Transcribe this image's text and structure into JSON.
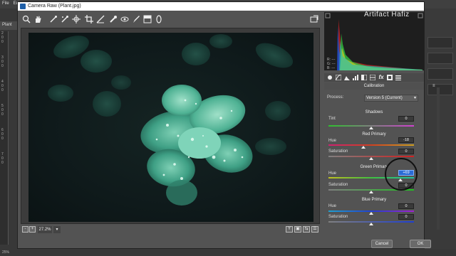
{
  "photoshop": {
    "menu": [
      "File",
      "Ed"
    ],
    "doc_tab": "Plant",
    "ruler_marks": [
      "2",
      "0",
      "0",
      "3",
      "0",
      "0",
      "4",
      "0",
      "0",
      "5",
      "0",
      "0",
      "6",
      "0",
      "0",
      "7",
      "0",
      "0",
      "8",
      "0",
      "0"
    ],
    "zoom_status": "25%"
  },
  "dialog": {
    "title": "Camera Raw (Plant.jpg)"
  },
  "toolbar": {
    "tools": [
      {
        "name": "zoom-tool",
        "glyph": "🔍"
      },
      {
        "name": "hand-tool",
        "glyph": "✋"
      },
      {
        "name": "white-balance-tool",
        "glyph": "✒"
      },
      {
        "name": "color-sampler-tool",
        "glyph": "✒"
      },
      {
        "name": "targeted-adjustment-tool",
        "glyph": "⊕"
      },
      {
        "name": "crop-tool",
        "glyph": "⌗"
      },
      {
        "name": "straighten-tool",
        "glyph": "⟋"
      },
      {
        "name": "spot-removal-tool",
        "glyph": "✺"
      },
      {
        "name": "red-eye-tool",
        "glyph": "⊙"
      },
      {
        "name": "adjustment-brush-tool",
        "glyph": "✎"
      },
      {
        "name": "graduated-filter-tool",
        "glyph": "▦"
      },
      {
        "name": "radial-filter-tool",
        "glyph": "○"
      }
    ],
    "open_prefs_icon": "open-dialog-icon"
  },
  "bottom_bar": {
    "zoom_out": "-",
    "zoom_in": "+",
    "zoom_value": "27.2%",
    "zoom_dropdown": "▾",
    "right_icons": [
      "Y",
      "▣",
      "⇆",
      "☰"
    ]
  },
  "watermark": "Artifact Hafiz",
  "rgb_readout": {
    "r": "R:",
    "g": "G:",
    "b": "B:",
    "r_val": "---",
    "g_val": "---",
    "b_val": "---"
  },
  "panel": {
    "title": "Calibration",
    "process_label": "Process:",
    "process_value": "Version 5 (Current)",
    "menu_icon": "≡",
    "shadows": {
      "title": "Shadows",
      "tint_label": "Tint",
      "tint_value": "0",
      "tint_pos": 0.5
    },
    "red": {
      "title": "Red Primary",
      "hue_label": "Hue",
      "hue_value": "-18",
      "hue_pos": 0.41,
      "sat_label": "Saturation",
      "sat_value": "0",
      "sat_pos": 0.5
    },
    "green": {
      "title": "Green Primary",
      "hue_label": "Hue",
      "hue_value": "+69",
      "hue_pos": 0.845,
      "sat_label": "Saturation",
      "sat_value": "0",
      "sat_pos": 0.5
    },
    "blue": {
      "title": "Blue Primary",
      "hue_label": "Hue",
      "hue_value": "0",
      "hue_pos": 0.5,
      "sat_label": "Saturation",
      "sat_value": "0",
      "sat_pos": 0.5
    }
  },
  "buttons": {
    "cancel": "Cancel",
    "ok": "OK"
  },
  "colors": {
    "accent": "#2a6bd6",
    "leaf": "#3fa085",
    "bg_dark": "#0f1a1b"
  }
}
